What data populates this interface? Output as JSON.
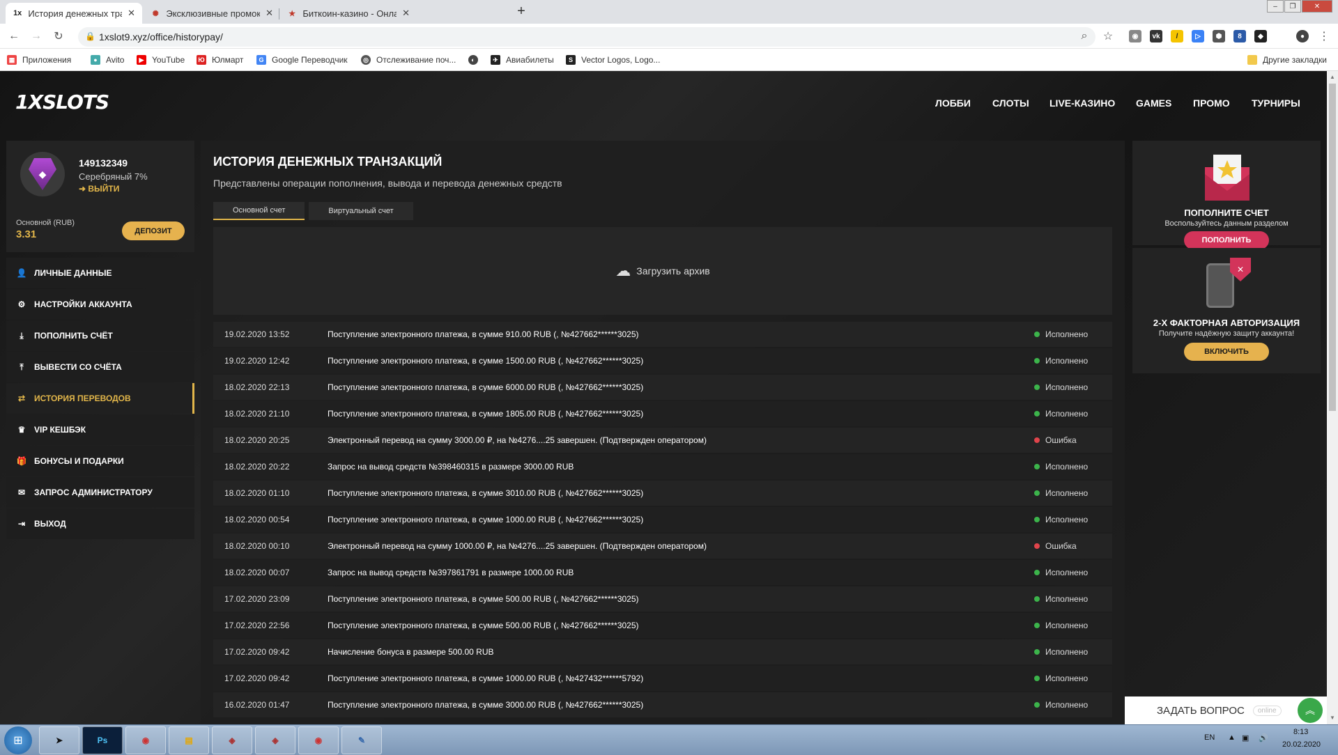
{
  "browser": {
    "tabs": [
      {
        "title": "История денежных транзакций",
        "icon": "1x-icon"
      },
      {
        "title": "Эксклюзивные промокоды на с",
        "icon": "promo-icon"
      },
      {
        "title": "Биткоин-казино - Онлайн-казин",
        "icon": "star-icon"
      }
    ],
    "url": "1xslot9.xyz/office/historypay/",
    "bookmarks": [
      "Приложения",
      "Avito",
      "YouTube",
      "Юлмарт",
      "Google Переводчик",
      "Отслеживание поч...",
      "Авиабилеты",
      "Vector Logos, Logo..."
    ],
    "other_bookmarks": "Другие закладки"
  },
  "site": {
    "logo": "1XSLOTS",
    "nav": [
      "ЛОББИ",
      "СЛОТЫ",
      "LIVE-КАЗИНО",
      "GAMES",
      "ПРОМО",
      "ТУРНИРЫ"
    ]
  },
  "profile": {
    "user_id": "149132349",
    "level": "Серебряный 7%",
    "logout": "ВЫЙТИ",
    "account_label": "Основной (RUB)",
    "balance": "3.31",
    "deposit_button": "ДЕПОЗИТ"
  },
  "menu": [
    {
      "label": "ЛИЧНЫЕ ДАННЫЕ",
      "icon": "user-plus-icon"
    },
    {
      "label": "НАСТРОЙКИ АККАУНТА",
      "icon": "settings-icon"
    },
    {
      "label": "ПОПОЛНИТЬ СЧЁТ",
      "icon": "download-icon"
    },
    {
      "label": "ВЫВЕСТИ СО СЧЁТА",
      "icon": "upload-icon"
    },
    {
      "label": "ИСТОРИЯ ПЕРЕВОДОВ",
      "icon": "transfer-icon"
    },
    {
      "label": "VIP КЕШБЭК",
      "icon": "crown-icon"
    },
    {
      "label": "БОНУСЫ И ПОДАРКИ",
      "icon": "gift-icon"
    },
    {
      "label": "ЗАПРОС АДМИНИСТРАТОРУ",
      "icon": "mail-icon"
    },
    {
      "label": "ВЫХОД",
      "icon": "exit-icon"
    }
  ],
  "main": {
    "title": "ИСТОРИЯ ДЕНЕЖНЫХ ТРАНЗАКЦИЙ",
    "subtitle": "Представлены операции пополнения, вывода и перевода денежных средств",
    "tabs": [
      "Основной счет",
      "Виртуальный счет"
    ],
    "archive": "Загрузить архив",
    "transactions": [
      {
        "date": "19.02.2020 13:52",
        "desc": "Поступление электронного платежа, в сумме 910.00 RUB (, №427662******3025)",
        "status": "Исполнено"
      },
      {
        "date": "19.02.2020 12:42",
        "desc": "Поступление электронного платежа, в сумме 1500.00 RUB (, №427662******3025)",
        "status": "Исполнено"
      },
      {
        "date": "18.02.2020 22:13",
        "desc": "Поступление электронного платежа, в сумме 6000.00 RUB (, №427662******3025)",
        "status": "Исполнено"
      },
      {
        "date": "18.02.2020 21:10",
        "desc": "Поступление электронного платежа, в сумме 1805.00 RUB (, №427662******3025)",
        "status": "Исполнено"
      },
      {
        "date": "18.02.2020 20:25",
        "desc": "Электронный перевод на сумму 3000.00 ₽, на №4276....25 завершен. (Подтвержден оператором)",
        "status": "Ошибка"
      },
      {
        "date": "18.02.2020 20:22",
        "desc": "Запрос на вывод средств №398460315 в размере 3000.00 RUB",
        "status": "Исполнено"
      },
      {
        "date": "18.02.2020 01:10",
        "desc": "Поступление электронного платежа, в сумме 3010.00 RUB (, №427662******3025)",
        "status": "Исполнено"
      },
      {
        "date": "18.02.2020 00:54",
        "desc": "Поступление электронного платежа, в сумме 1000.00 RUB (, №427662******3025)",
        "status": "Исполнено"
      },
      {
        "date": "18.02.2020 00:10",
        "desc": "Электронный перевод на сумму 1000.00 ₽, на №4276....25 завершен. (Подтвержден оператором)",
        "status": "Ошибка"
      },
      {
        "date": "18.02.2020 00:07",
        "desc": "Запрос на вывод средств №397861791 в размере 1000.00 RUB",
        "status": "Исполнено"
      },
      {
        "date": "17.02.2020 23:09",
        "desc": "Поступление электронного платежа, в сумме 500.00 RUB (, №427662******3025)",
        "status": "Исполнено"
      },
      {
        "date": "17.02.2020 22:56",
        "desc": "Поступление электронного платежа, в сумме 500.00 RUB (, №427662******3025)",
        "status": "Исполнено"
      },
      {
        "date": "17.02.2020 09:42",
        "desc": "Начисление бонуса в размере 500.00 RUB",
        "status": "Исполнено"
      },
      {
        "date": "17.02.2020 09:42",
        "desc": "Поступление электронного платежа, в сумме 1000.00 RUB (, №427432******5792)",
        "status": "Исполнено"
      },
      {
        "date": "16.02.2020 01:47",
        "desc": "Поступление электронного платежа, в сумме 3000.00 RUB (, №427662******3025)",
        "status": "Исполнено"
      }
    ]
  },
  "right": {
    "deposit_card": {
      "title": "ПОПОЛНИТЕ СЧЕТ",
      "subtitle": "Воспользуйтесь данным разделом",
      "button": "ПОПОЛНИТЬ"
    },
    "twofa_card": {
      "title": "2-Х ФАКТОРНАЯ АВТОРИЗАЦИЯ",
      "subtitle": "Получите надёжную защиту аккаунта!",
      "button": "ВКЛЮЧИТЬ"
    }
  },
  "chat": {
    "label": "ЗАДАТЬ ВОПРОС",
    "status": "online"
  },
  "taskbar": {
    "lang": "EN",
    "time": "8:13",
    "date": "20.02.2020"
  },
  "colors": {
    "accent": "#e2b64a",
    "success": "#3cb44b",
    "error": "#e0444b",
    "pink": "#d3345a"
  }
}
